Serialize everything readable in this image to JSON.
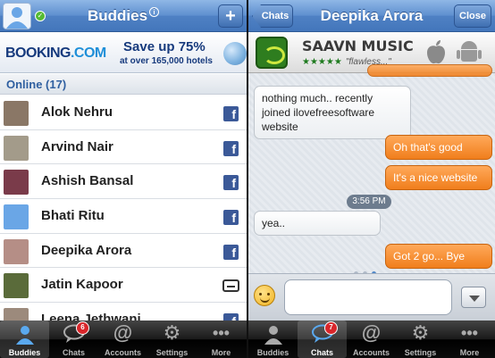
{
  "left": {
    "title": "Buddies",
    "add_label": "+",
    "status_label": "✓",
    "info_label": "i",
    "ad": {
      "brand_main": "BOOKING",
      "brand_suffix": ".COM",
      "headline": "Save up 75%",
      "subline": "at over 165,000 hotels"
    },
    "section_label": "Online (17)",
    "contacts": [
      {
        "name": "Alok Nehru",
        "service": "facebook",
        "fb_label": "f",
        "avatar_color": "#8a7766"
      },
      {
        "name": "Arvind Nair",
        "service": "facebook",
        "fb_label": "f",
        "avatar_color": "#a39b8a"
      },
      {
        "name": "Ashish Bansal",
        "service": "facebook",
        "fb_label": "f",
        "avatar_color": "#7a3b4a"
      },
      {
        "name": "Bhati Ritu",
        "service": "facebook",
        "fb_label": "f",
        "avatar_color": "#6aa6e6"
      },
      {
        "name": "Deepika Arora",
        "service": "facebook",
        "fb_label": "f",
        "avatar_color": "#b58e86"
      },
      {
        "name": "Jatin Kapoor",
        "service": "bbm",
        "fb_label": "",
        "avatar_color": "#5a6b3a"
      },
      {
        "name": "Leena Jethwani",
        "service": "facebook",
        "fb_label": "f",
        "avatar_color": "#9c8a7c"
      }
    ]
  },
  "right": {
    "title": "Deepika Arora",
    "back_label": "Chats",
    "close_label": "Close",
    "ad": {
      "title": "SAAVN MUSIC",
      "stars": "★★★★★",
      "quote": "\"flawless...\""
    },
    "messages": [
      {
        "from": "them",
        "text": "nothing much.. recently joined ilovefreesoftware website"
      },
      {
        "from": "me",
        "text": "Oh that's good"
      },
      {
        "from": "me",
        "text": "It's a nice website"
      },
      {
        "from": "them",
        "text": "yea.."
      },
      {
        "from": "me",
        "text": "Got 2 go... Bye"
      }
    ],
    "timestamp": "3:56 PM",
    "input_value": ""
  },
  "tabs": {
    "buddies": "Buddies",
    "chats": "Chats",
    "accounts": "Accounts",
    "settings": "Settings",
    "more": "More",
    "left_chats_badge": "6",
    "right_chats_badge": "7"
  },
  "colors": {
    "nav_blue": "#4f81c4",
    "bubble_orange": "#f07e1c",
    "facebook_blue": "#3b5998",
    "badge_red": "#d9262b"
  }
}
